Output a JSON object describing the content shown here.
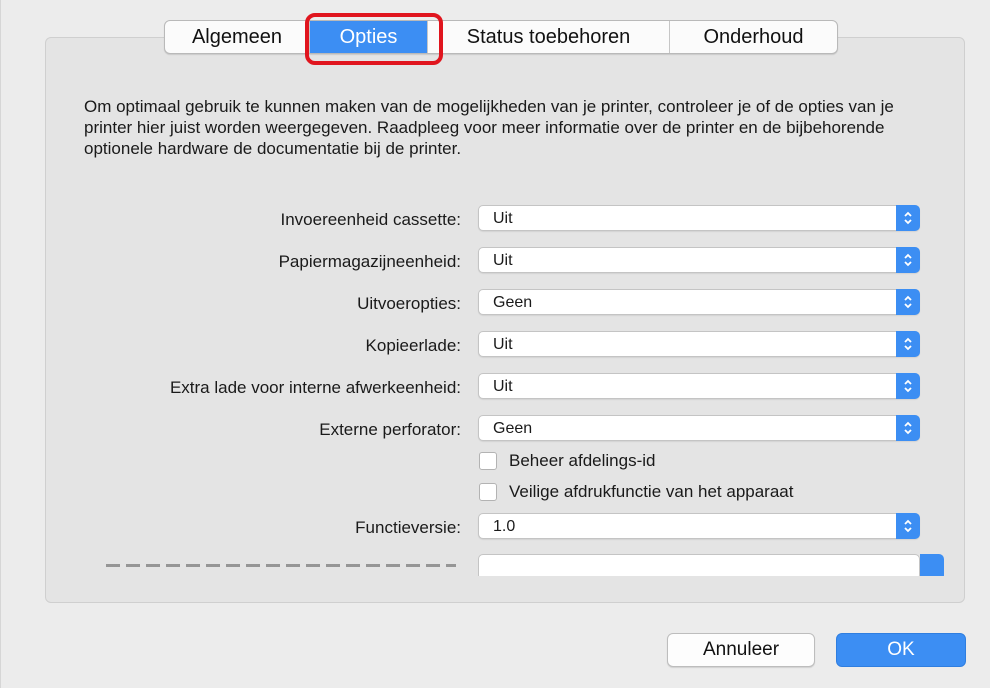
{
  "tabs": [
    {
      "label": "Algemeen"
    },
    {
      "label": "Opties"
    },
    {
      "label": "Status toebehoren"
    },
    {
      "label": "Onderhoud"
    }
  ],
  "selected_tab": "Opties",
  "description": "Om optimaal gebruik te kunnen maken van de mogelijkheden van je printer, controleer je of de opties van je printer hier juist worden weergegeven. Raadpleeg voor meer informatie over de printer en de bijbehorende optionele hardware de documentatie bij de printer.",
  "options": [
    {
      "label": "Invoereenheid cassette:",
      "value": "Uit"
    },
    {
      "label": "Papiermagazijneenheid:",
      "value": "Uit"
    },
    {
      "label": "Uitvoeropties:",
      "value": "Geen"
    },
    {
      "label": "Kopieerlade:",
      "value": "Uit"
    },
    {
      "label": "Extra lade voor interne afwerkeenheid:",
      "value": "Uit"
    },
    {
      "label": "Externe perforator:",
      "value": "Geen"
    }
  ],
  "checkboxes": [
    {
      "label": "Beheer afdelings-id",
      "checked": false
    },
    {
      "label": "Veilige afdrukfunctie van het apparaat",
      "checked": false
    }
  ],
  "version": {
    "label": "Functieversie:",
    "value": "1.0"
  },
  "buttons": {
    "cancel": "Annuleer",
    "ok": "OK"
  },
  "colors": {
    "accent": "#3c8ef3",
    "highlight": "#e0151e"
  }
}
